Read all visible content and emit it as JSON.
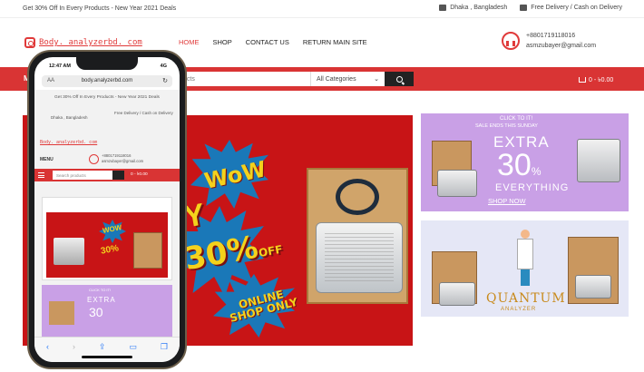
{
  "topbar": {
    "promo": "Get 30% Off In Every Products - New Year 2021 Deals",
    "location": "Dhaka , Bangladesh",
    "delivery": "Free Delivery / Cash on Delivery"
  },
  "header": {
    "logo_text": "Body. analyzerbd. com",
    "nav": [
      {
        "label": "HOME",
        "active": true
      },
      {
        "label": "SHOP",
        "active": false
      },
      {
        "label": "CONTACT US",
        "active": false
      },
      {
        "label": "RETURN MAIN SITE",
        "active": false
      }
    ],
    "phone": "+8801719118016",
    "email": "asmzubayer@gmail.com"
  },
  "searchbar": {
    "menu_label": "M",
    "placeholder": "products",
    "category": "All Categories",
    "cart": "0 - ৳0.00"
  },
  "hero": {
    "wow": "WoW",
    "percent": "30%",
    "off": "OFF",
    "online": "ONLINE",
    "shop_only": "SHOP ONLY",
    "left_letter": "Y"
  },
  "side_banner_1": {
    "click": "CLICK TO IT!",
    "sale": "SALE ENDS THIS SUNDAY",
    "extra": "EXTRA",
    "number": "30",
    "pct": "%",
    "everything": "EVERYTHING",
    "shop_now": "SHOP NOW"
  },
  "side_banner_2": {
    "title": "QUANTUM",
    "subtitle": "ANALYZER"
  },
  "phone": {
    "time": "12:47 AM",
    "signal": "4G",
    "aa": "AA",
    "url": "body.analyzerbd.com",
    "promo": "Get 30% Off In Every Products - New Year 2021 Deals",
    "location": "Dhaka , Bangladesh",
    "delivery": "Free Delivery / Cash on Delivery",
    "logo_text": "Body. analyzerbd. com",
    "menu": "MENU",
    "phone": "+8801719118016",
    "email": "asmzubayer@gmail.com",
    "search_placeholder": "Search products",
    "cart": "0 - ৳0.00",
    "mini_wow": "WOW",
    "mini_30": "30%",
    "card2_click": "CLICK TO IT!",
    "card2_extra": "EXTRA",
    "card2_num": "30"
  },
  "colors": {
    "accent": "#d93434",
    "hero_bg": "#c81416",
    "burst": "#1a78b8",
    "yellow": "#f4d21c",
    "lilac": "#c9a0e6"
  }
}
